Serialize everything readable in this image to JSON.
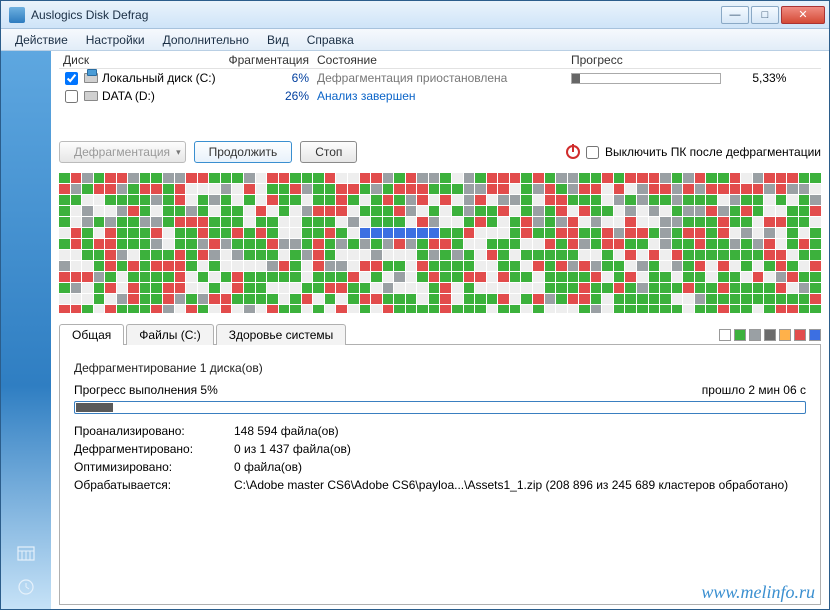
{
  "title": "Auslogics Disk Defrag",
  "menu": {
    "action": "Действие",
    "settings": "Настройки",
    "advanced": "Дополнительно",
    "view": "Вид",
    "help": "Справка"
  },
  "columns": {
    "disk": "Диск",
    "frag": "Фрагментация",
    "state": "Состояние",
    "progress": "Прогресс"
  },
  "disks": [
    {
      "checked": true,
      "name": "Локальный диск (C:)",
      "frag": "6%",
      "state": "Дефрагментация приостановлена",
      "state_class": "state-paused",
      "progress_pct": "5,33%",
      "progress_fill": 5.33
    },
    {
      "checked": false,
      "name": "DATA (D:)",
      "frag": "26%",
      "state": "Анализ завершен",
      "state_class": "state-link",
      "progress_pct": "",
      "progress_fill": null
    }
  ],
  "buttons": {
    "defrag": "Дефрагментация",
    "resume": "Продолжить",
    "stop": "Стоп"
  },
  "shutdown_label": "Выключить ПК после дефрагментации",
  "tabs": {
    "general": "Общая",
    "files": "Файлы (C:)",
    "health": "Здоровье системы"
  },
  "legend_colors": [
    "#ffffff",
    "#3cb13c",
    "#9aa0a4",
    "#6c6c6c",
    "#ffb14a",
    "#e24c4c",
    "#3c6fe2"
  ],
  "info": {
    "heading": "Дефрагментирование 1 диска(ов)",
    "progress_label": "Прогресс выполнения 5%",
    "elapsed": "прошло 2 мин 06 с",
    "progress_fill": 5,
    "rows": {
      "analyzed_label": "Проанализировано:",
      "analyzed_val": "148 594 файла(ов)",
      "defragged_label": "Дефрагментировано:",
      "defragged_val": "0 из 1 437 файла(ов)",
      "optimized_label": "Оптимизировано:",
      "optimized_val": "0 файла(ов)",
      "processing_label": "Обрабатывается:",
      "processing_val": "C:\\Adobe master CS6\\Adobe CS6\\payloa...\\Assets1_1.zip (208 896 из 245 689 кластеров обработано)"
    }
  },
  "watermark": "www.melinfo.ru",
  "cluster_seed": 20240521
}
